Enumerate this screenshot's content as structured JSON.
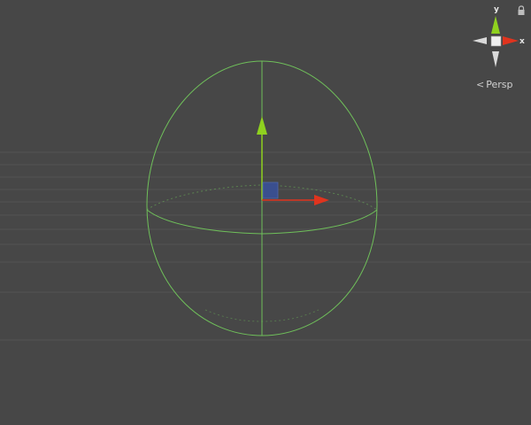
{
  "viewport": {
    "background": "#474747"
  },
  "scene": {
    "grid_color": "#5a5a5a",
    "collider_color": "#6fbf5a",
    "handle_colors": {
      "x": "#e0341e",
      "y": "#8fd11f",
      "center": "#3a4f8f"
    },
    "collider_shape": "capsule",
    "tool": "move"
  },
  "gizmo": {
    "axis_labels": {
      "x": "x",
      "y": "y"
    },
    "colors": {
      "x": "#e0341e",
      "y": "#8fd11f",
      "neutral": "#d9d9d9",
      "cube": "#f0f0f0"
    },
    "lock_icon": "lock-icon",
    "projection_icon": "perspective-icon",
    "projection_label": "Persp"
  }
}
